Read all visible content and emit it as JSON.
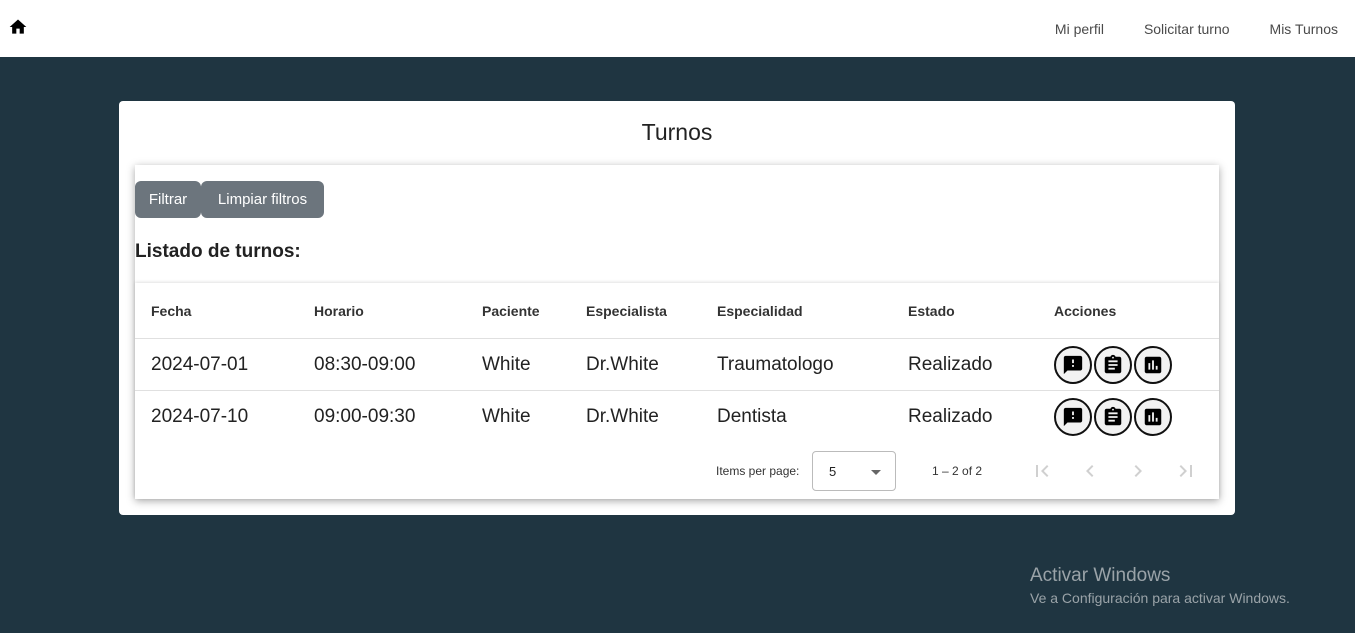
{
  "header": {
    "home_icon": "home-icon",
    "nav": [
      "Mi perfil",
      "Solicitar turno",
      "Mis Turnos"
    ]
  },
  "card": {
    "title": "Turnos",
    "buttons": {
      "filter": "Filtrar",
      "clear": "Limpiar filtros"
    },
    "list_title": "Listado de turnos:"
  },
  "table": {
    "columns": [
      "Fecha",
      "Horario",
      "Paciente",
      "Especialista",
      "Especialidad",
      "Estado",
      "Acciones"
    ],
    "rows": [
      {
        "fecha": "2024-07-01",
        "horario": "08:30-09:00",
        "paciente": "White",
        "especialista": "Dr.White",
        "especialidad": "Traumatologo",
        "estado": "Realizado"
      },
      {
        "fecha": "2024-07-10",
        "horario": "09:00-09:30",
        "paciente": "White",
        "especialista": "Dr.White",
        "especialidad": "Dentista",
        "estado": "Realizado"
      }
    ],
    "action_icons": [
      "feedback-icon",
      "clipboard-icon",
      "chart-icon"
    ]
  },
  "paginator": {
    "items_label": "Items per page:",
    "page_size": "5",
    "range": "1 – 2 of 2"
  },
  "watermark": {
    "title": "Activar Windows",
    "subtitle": "Ve a Configuración para activar Windows."
  },
  "colors": {
    "background": "#1f3541",
    "button": "#6c757d"
  }
}
